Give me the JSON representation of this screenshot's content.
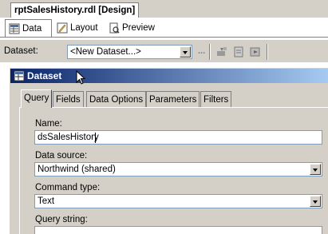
{
  "document": {
    "tab_title": "rptSalesHistory.rdl [Design]"
  },
  "designer_tabs": [
    {
      "label": "Data",
      "icon": "data-icon",
      "active": true
    },
    {
      "label": "Layout",
      "icon": "layout-icon",
      "active": false
    },
    {
      "label": "Preview",
      "icon": "preview-icon",
      "active": false
    }
  ],
  "toolbar": {
    "dataset_label": "Dataset:",
    "dataset_value": "<New Dataset...>",
    "more_label": "...",
    "icons": [
      "edit-dataset-icon",
      "delete-dataset-icon",
      "refresh-fields-icon",
      "run-icon"
    ]
  },
  "dialog": {
    "title": "Dataset",
    "title_icon": "dataset-icon",
    "tabs": [
      "Query",
      "Fields",
      "Data Options",
      "Parameters",
      "Filters"
    ],
    "active_tab": "Query",
    "name_label": "Name:",
    "name_value": "dsSalesHistory",
    "datasource_label": "Data source:",
    "datasource_value": "Northwind (shared)",
    "commandtype_label": "Command type:",
    "commandtype_value": "Text",
    "querystring_label": "Query string:",
    "titlebar_gradient": [
      "#0a246a",
      "#a6caf0"
    ]
  },
  "colors": {
    "window": "#d4d0c8",
    "field_border": "#7f9db9"
  }
}
